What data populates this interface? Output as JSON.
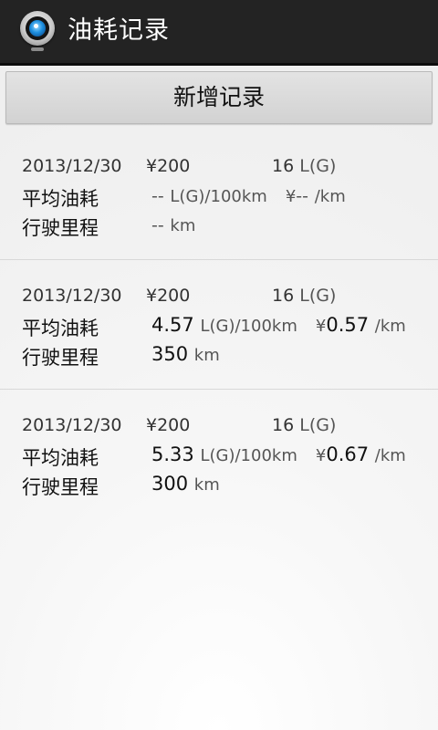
{
  "app": {
    "title": "油耗记录"
  },
  "toolbar": {
    "add_label": "新增记录"
  },
  "labels": {
    "avg_consumption": "平均油耗",
    "mileage": "行驶里程"
  },
  "units": {
    "liters": "L(G)",
    "consumption": "L(G)/100km",
    "yuan_sign": "¥",
    "per_km": "/km",
    "km": "km"
  },
  "records": [
    {
      "date": "2013/12/30",
      "amount": "200",
      "fuel": "16",
      "consumption": "--",
      "cost_per_km": "--",
      "distance": "--"
    },
    {
      "date": "2013/12/30",
      "amount": "200",
      "fuel": "16",
      "consumption": "4.57",
      "cost_per_km": "0.57",
      "distance": "350"
    },
    {
      "date": "2013/12/30",
      "amount": "200",
      "fuel": "16",
      "consumption": "5.33",
      "cost_per_km": "0.67",
      "distance": "300"
    }
  ]
}
